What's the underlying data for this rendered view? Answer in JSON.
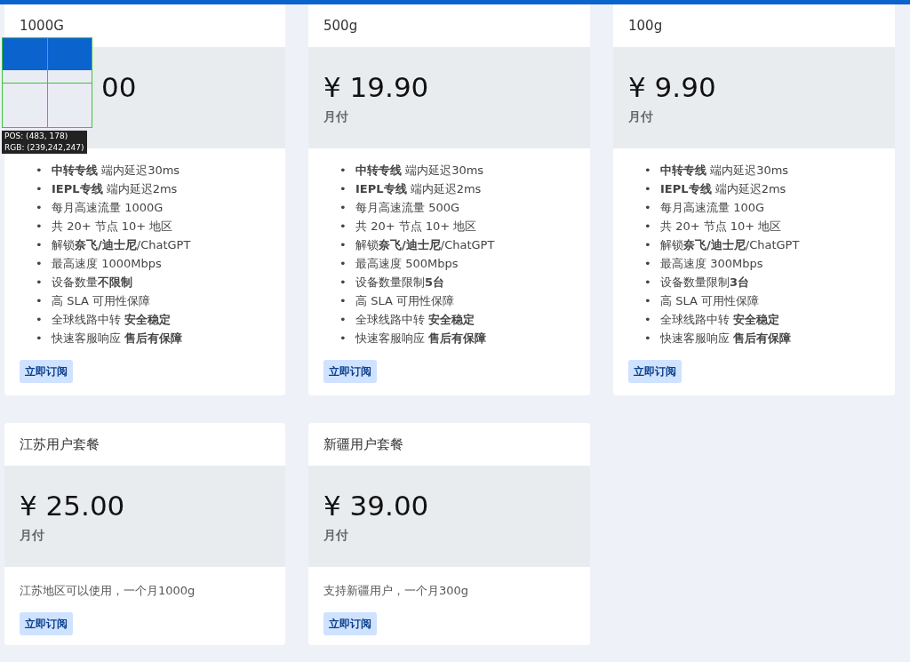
{
  "plans": [
    {
      "title": "1000G",
      "price": "00",
      "features": [
        "**中转专线** 端内延迟30ms",
        "**IEPL专线** 端内延迟2ms",
        "每月高速流量 1000G",
        "共 20+ 节点 10+ 地区",
        "解锁**奈飞/迪士尼**/ChatGPT",
        "最高速度 1000Mbps",
        "设备数量**不限制**",
        "高 SLA 可用性保障",
        "全球线路中转 **安全稳定**",
        "快速客服响应 **售后有保障**"
      ],
      "button": "立即订阅"
    },
    {
      "title": "500g",
      "price": "¥ 19.90",
      "period": "月付",
      "features": [
        "**中转专线** 端内延迟30ms",
        "**IEPL专线** 端内延迟2ms",
        "每月高速流量 500G",
        "共 20+ 节点 10+ 地区",
        "解锁**奈飞/迪士尼**/ChatGPT",
        "最高速度 500Mbps",
        "设备数量限制**5台**",
        "高 SLA 可用性保障",
        "全球线路中转 **安全稳定**",
        "快速客服响应 **售后有保障**"
      ],
      "button": "立即订阅"
    },
    {
      "title": "100g",
      "price": "¥ 9.90",
      "period": "月付",
      "features": [
        "**中转专线** 端内延迟30ms",
        "**IEPL专线** 端内延迟2ms",
        "每月高速流量 100G",
        "共 20+ 节点 10+ 地区",
        "解锁**奈飞/迪士尼**/ChatGPT",
        "最高速度 300Mbps",
        "设备数量限制**3台**",
        "高 SLA 可用性保障",
        "全球线路中转 **安全稳定**",
        "快速客服响应 **售后有保障**"
      ],
      "button": "立即订阅"
    },
    {
      "title": "江苏用户套餐",
      "price": "¥ 25.00",
      "period": "月付",
      "description": "江苏地区可以使用，一个月1000g",
      "button": "立即订阅"
    },
    {
      "title": "新疆用户套餐",
      "price": "¥ 39.00",
      "period": "月付",
      "description": "支持新疆用户，一个月300g",
      "button": "立即订阅"
    }
  ],
  "bullet": "•",
  "color_picker": {
    "pos": "POS: (483, 178)",
    "rgb": "RGB: (239,242,247)"
  }
}
